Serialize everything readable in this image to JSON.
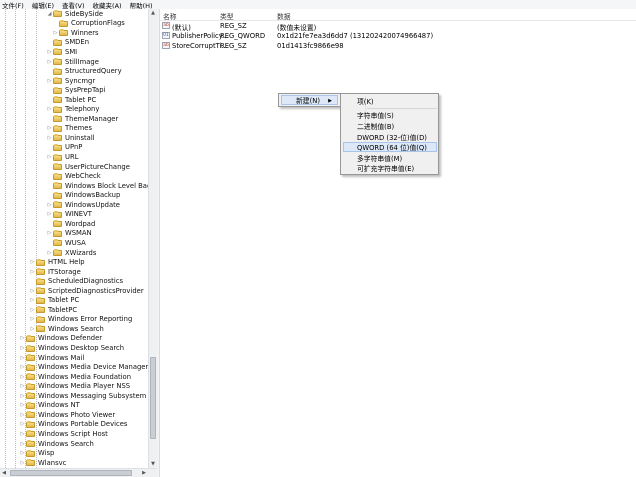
{
  "menubar": {
    "items": [
      "文件(F)",
      "编辑(E)",
      "查看(V)",
      "收藏夹(A)",
      "帮助(H)"
    ]
  },
  "tree": {
    "nodes": [
      {
        "label": "SideBySide",
        "exp": "◢"
      },
      {
        "label": "CorruptionFlags",
        "exp": ""
      },
      {
        "label": "Winners",
        "exp": "▷"
      },
      {
        "label": "SMDEn",
        "exp": ""
      },
      {
        "label": "SMI",
        "exp": "▷"
      },
      {
        "label": "StillImage",
        "exp": "▷"
      },
      {
        "label": "StructuredQuery",
        "exp": ""
      },
      {
        "label": "Syncmgr",
        "exp": "▷"
      },
      {
        "label": "SysPrepTapi",
        "exp": ""
      },
      {
        "label": "Tablet PC",
        "exp": ""
      },
      {
        "label": "Telephony",
        "exp": "▷"
      },
      {
        "label": "ThemeManager",
        "exp": ""
      },
      {
        "label": "Themes",
        "exp": "▷"
      },
      {
        "label": "Uninstall",
        "exp": "▷"
      },
      {
        "label": "UPnP",
        "exp": ""
      },
      {
        "label": "URL",
        "exp": "▷"
      },
      {
        "label": "UserPictureChange",
        "exp": ""
      },
      {
        "label": "WebCheck",
        "exp": ""
      },
      {
        "label": "Windows Block Level Backup",
        "exp": ""
      },
      {
        "label": "WindowsBackup",
        "exp": ""
      },
      {
        "label": "WindowsUpdate",
        "exp": "▷"
      },
      {
        "label": "WINEVT",
        "exp": "▷"
      },
      {
        "label": "Wordpad",
        "exp": ""
      },
      {
        "label": "WSMAN",
        "exp": "▷"
      },
      {
        "label": "WUSA",
        "exp": ""
      },
      {
        "label": "XWizards",
        "exp": "▷"
      },
      {
        "label": "HTML Help",
        "exp": "▷"
      },
      {
        "label": "ITStorage",
        "exp": "▷"
      },
      {
        "label": "ScheduledDiagnostics",
        "exp": ""
      },
      {
        "label": "ScriptedDiagnosticsProvider",
        "exp": "▷"
      },
      {
        "label": "Tablet PC",
        "exp": "▷"
      },
      {
        "label": "TabletPC",
        "exp": "▷"
      },
      {
        "label": "Windows Error Reporting",
        "exp": "▷"
      },
      {
        "label": "Windows Search",
        "exp": "▷"
      },
      {
        "label": "Windows Defender",
        "exp": "▷"
      },
      {
        "label": "Windows Desktop Search",
        "exp": "▷"
      },
      {
        "label": "Windows Mail",
        "exp": "▷"
      },
      {
        "label": "Windows Media Device Manager",
        "exp": "▷"
      },
      {
        "label": "Windows Media Foundation",
        "exp": "▷"
      },
      {
        "label": "Windows Media Player NSS",
        "exp": "▷"
      },
      {
        "label": "Windows Messaging Subsystem",
        "exp": "▷"
      },
      {
        "label": "Windows NT",
        "exp": "▷"
      },
      {
        "label": "Windows Photo Viewer",
        "exp": "▷"
      },
      {
        "label": "Windows Portable Devices",
        "exp": "▷"
      },
      {
        "label": "Windows Script Host",
        "exp": "▷"
      },
      {
        "label": "Windows Search",
        "exp": "▷"
      },
      {
        "label": "Wisp",
        "exp": "▷"
      },
      {
        "label": "Wlansvc",
        "exp": "▷"
      }
    ]
  },
  "list": {
    "headers": {
      "name": "名称",
      "type": "类型",
      "data": "数据"
    },
    "rows": [
      {
        "name": "(默认)",
        "type": "REG_SZ",
        "data": "(数值未设置)",
        "icon": "ab"
      },
      {
        "name": "PublisherPolicy...",
        "type": "REG_QWORD",
        "data": "0x1d21fe7ea3d6dd7 (131202420074966487)",
        "icon": "bin"
      },
      {
        "name": "StoreCorruptTi...",
        "type": "REG_SZ",
        "data": "01d1413fc9866e98",
        "icon": "ab"
      }
    ]
  },
  "context_menu": {
    "new_label": "新建(N)",
    "submenu": [
      {
        "label": "项(K)"
      },
      {
        "label": "字符串值(S)"
      },
      {
        "label": "二进制值(B)"
      },
      {
        "label": "DWORD (32-位)值(D)"
      },
      {
        "label": "QWORD (64 位)值(Q)"
      },
      {
        "label": "多字符串值(M)"
      },
      {
        "label": "可扩充字符串值(E)"
      }
    ]
  }
}
